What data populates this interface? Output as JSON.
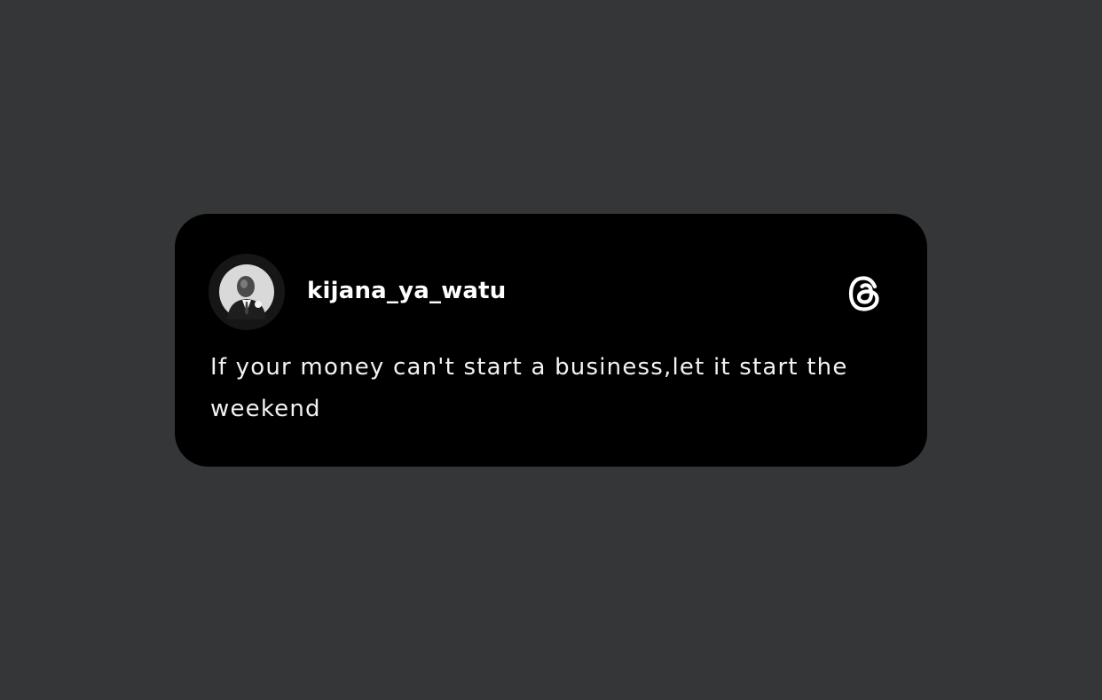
{
  "post": {
    "username": "kijana_ya_watu",
    "text": "If your money can't start a business,let it start the weekend"
  },
  "icons": {
    "avatar": "profile-photo",
    "platform": "threads-logo-icon"
  },
  "colors": {
    "background": "#353638",
    "card": "#000000",
    "text": "#ffffff"
  }
}
